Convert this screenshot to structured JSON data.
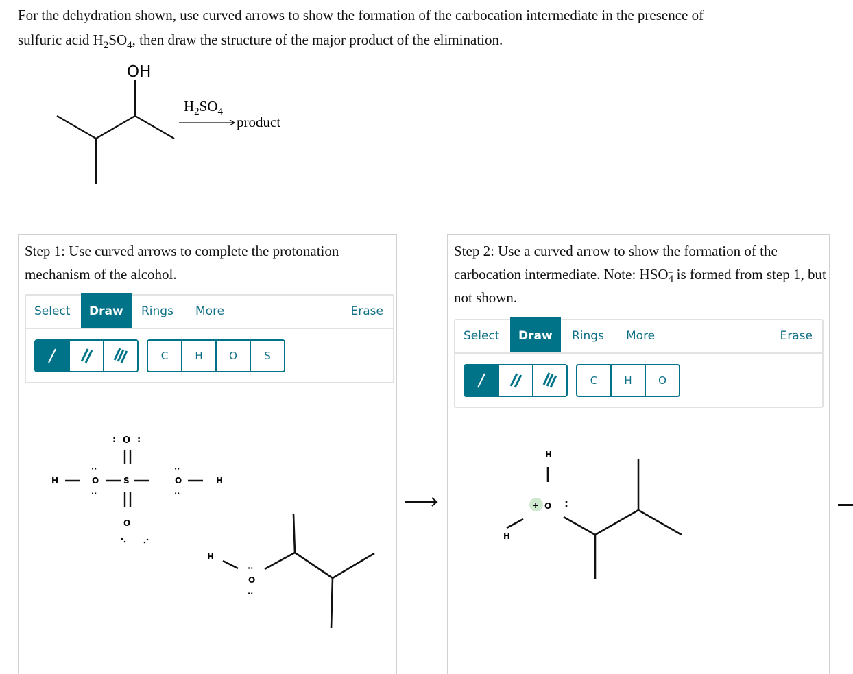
{
  "question": {
    "line1": "For the dehydration shown, use curved arrows to show the formation of the carbocation intermediate in the presence of",
    "line2_pre": "sulfuric acid H",
    "line2_sub1": "2",
    "line2_mid": "SO",
    "line2_sub2": "4",
    "line2_post": ", then draw the structure of the major product of the elimination."
  },
  "reaction": {
    "substituent": "OH",
    "reagent": "H",
    "reagent_sub1": "2",
    "reagent_mid": "SO",
    "reagent_sub2": "4",
    "product_label": "product"
  },
  "step1": {
    "title": "Step 1: Use curved arrows to complete the protonation mechanism of the alcohol.",
    "tabs": [
      "Select",
      "Draw",
      "Rings",
      "More"
    ],
    "active_tab": "Draw",
    "erase_label": "Erase",
    "bond_buttons": [
      "single-bond",
      "double-bond",
      "triple-bond"
    ],
    "selected_bond": "single-bond",
    "atom_buttons": [
      "C",
      "H",
      "O",
      "S"
    ],
    "molecules": {
      "acid_atoms": {
        "o_top": "O",
        "s": "S",
        "o_left": "O",
        "o_right": "O",
        "o_bottom": "O",
        "h_left": "H",
        "h_right": "H"
      },
      "alcohol_atoms": {
        "h": "H",
        "o": "O"
      }
    }
  },
  "step2": {
    "title_pre": "Step 2: Use a curved arrow to show the formation of the carbocation intermediate. Note: HSO",
    "title_sub": "4",
    "title_sup": "−",
    "title_post": " is formed from step 1, but not shown.",
    "tabs": [
      "Select",
      "Draw",
      "Rings",
      "More"
    ],
    "active_tab": "Draw",
    "erase_label": "Erase",
    "bond_buttons": [
      "single-bond",
      "double-bond",
      "triple-bond"
    ],
    "selected_bond": "single-bond",
    "atom_buttons": [
      "C",
      "H",
      "O"
    ],
    "molecule": {
      "h_top": "H",
      "h_left": "H",
      "o": "O",
      "charge": "+"
    }
  },
  "colors": {
    "accent": "#007389",
    "accent_text": "#0f6f86",
    "panel_border": "#d0d0d0",
    "charge_highlight": "#cfe9cf"
  }
}
